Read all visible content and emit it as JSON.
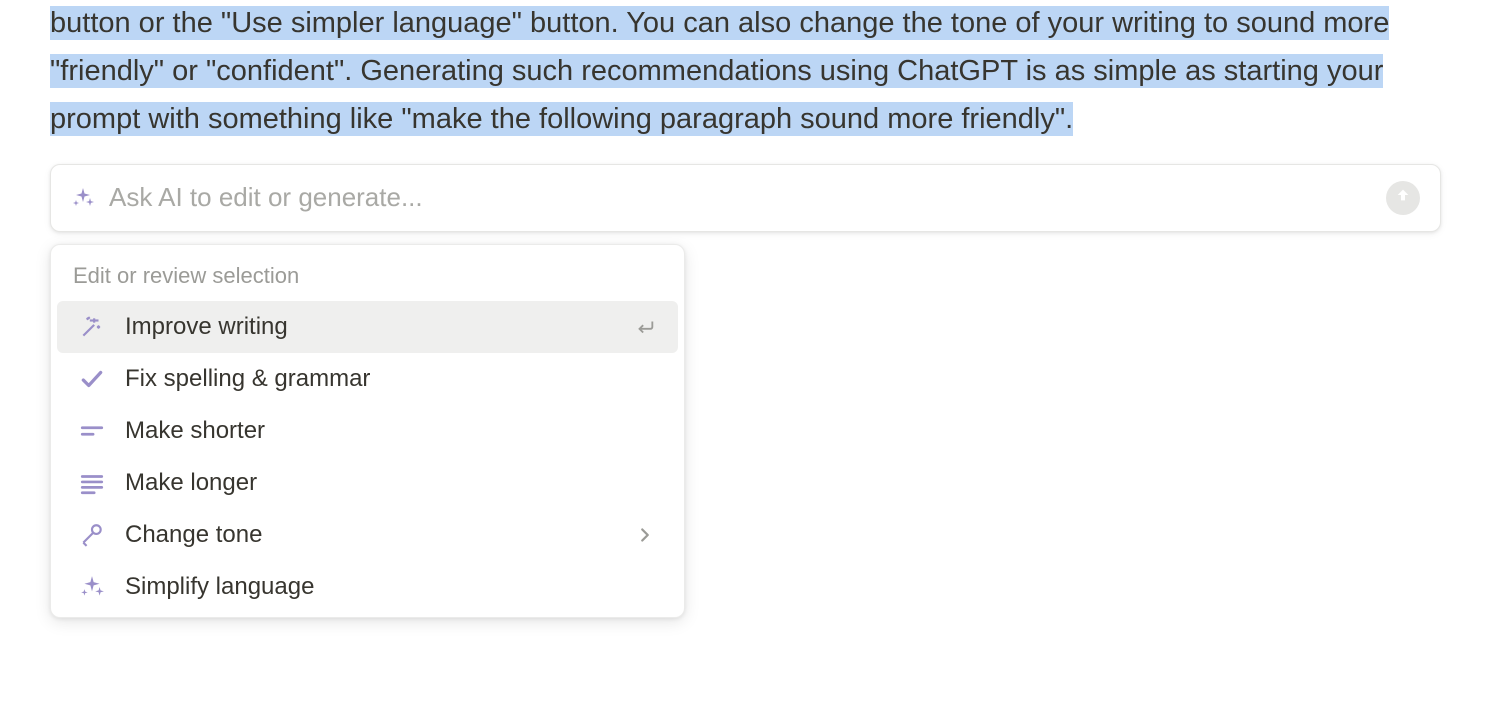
{
  "content": {
    "highlighted_text": "button or the \"Use simpler language\" button. You can also change the tone of your writing to sound more \"friendly\" or \"confident\". Generating such recommendations using ChatGPT is as simple as starting your prompt with something like \"make the following paragraph sound more friendly\"."
  },
  "ai_bar": {
    "placeholder": "Ask AI to edit or generate..."
  },
  "menu": {
    "header": "Edit or review selection",
    "items": [
      {
        "icon": "wand-icon",
        "label": "Improve writing",
        "trailing": "enter-icon",
        "highlighted": true
      },
      {
        "icon": "check-icon",
        "label": "Fix spelling & grammar",
        "trailing": null,
        "highlighted": false
      },
      {
        "icon": "shorter-icon",
        "label": "Make shorter",
        "trailing": null,
        "highlighted": false
      },
      {
        "icon": "longer-icon",
        "label": "Make longer",
        "trailing": null,
        "highlighted": false
      },
      {
        "icon": "mic-icon",
        "label": "Change tone",
        "trailing": "chevron-right-icon",
        "highlighted": false
      },
      {
        "icon": "sparkle-icon",
        "label": "Simplify language",
        "trailing": null,
        "highlighted": false
      }
    ]
  }
}
